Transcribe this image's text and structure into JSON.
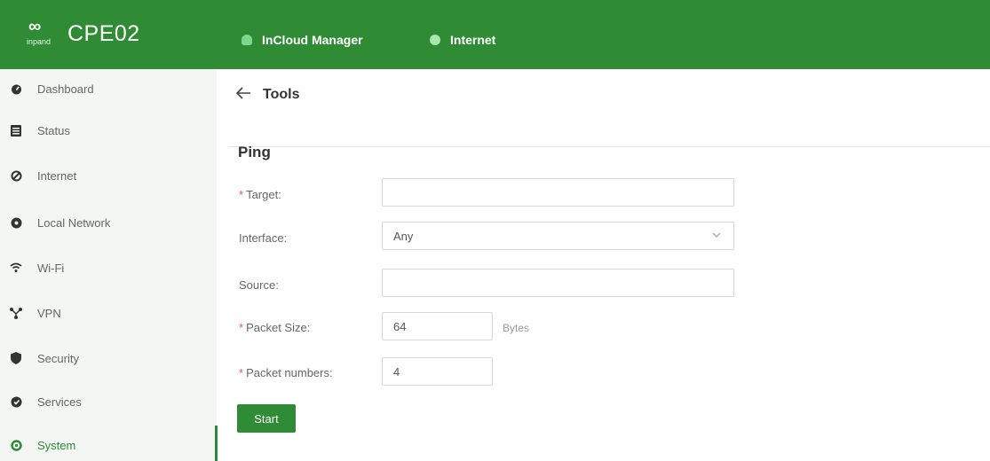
{
  "header": {
    "logo_mark": "∞",
    "logo_sub": "inpand",
    "device_name": "CPE02",
    "status_items": [
      {
        "label": "InCloud Manager",
        "icon": "cloud-icon",
        "color": "#7fd88a"
      },
      {
        "label": "Internet",
        "icon": "internet-status-dot",
        "color": "#a8e8ad"
      }
    ],
    "bg_color": "#2f8b34"
  },
  "sidebar": {
    "items": [
      {
        "label": "Dashboard",
        "icon": "dashboard-icon"
      },
      {
        "label": "Status",
        "icon": "status-icon"
      },
      {
        "label": "Internet",
        "icon": "internet-icon"
      },
      {
        "label": "Local Network",
        "icon": "local-network-icon"
      },
      {
        "label": "Wi-Fi",
        "icon": "wifi-icon"
      },
      {
        "label": "VPN",
        "icon": "vpn-icon"
      },
      {
        "label": "Security",
        "icon": "security-icon"
      },
      {
        "label": "Services",
        "icon": "services-icon"
      },
      {
        "label": "System",
        "icon": "system-icon",
        "active": true
      }
    ]
  },
  "page": {
    "title": "Tools",
    "section": "Ping",
    "fields": {
      "target": {
        "label": "Target",
        "value": "",
        "required": true
      },
      "interface": {
        "label": "Interface",
        "value": "Any"
      },
      "source": {
        "label": "Source",
        "value": ""
      },
      "packet_size": {
        "label": "Packet Size",
        "value": "64",
        "unit": "Bytes",
        "required": true
      },
      "packet_numbers": {
        "label": "Packet numbers",
        "value": "4",
        "required": true
      }
    },
    "start_label": "Start"
  },
  "colors": {
    "accent": "#2f8b34",
    "sidebar_bg": "#f3f6f3",
    "required": "#e05a5a"
  }
}
